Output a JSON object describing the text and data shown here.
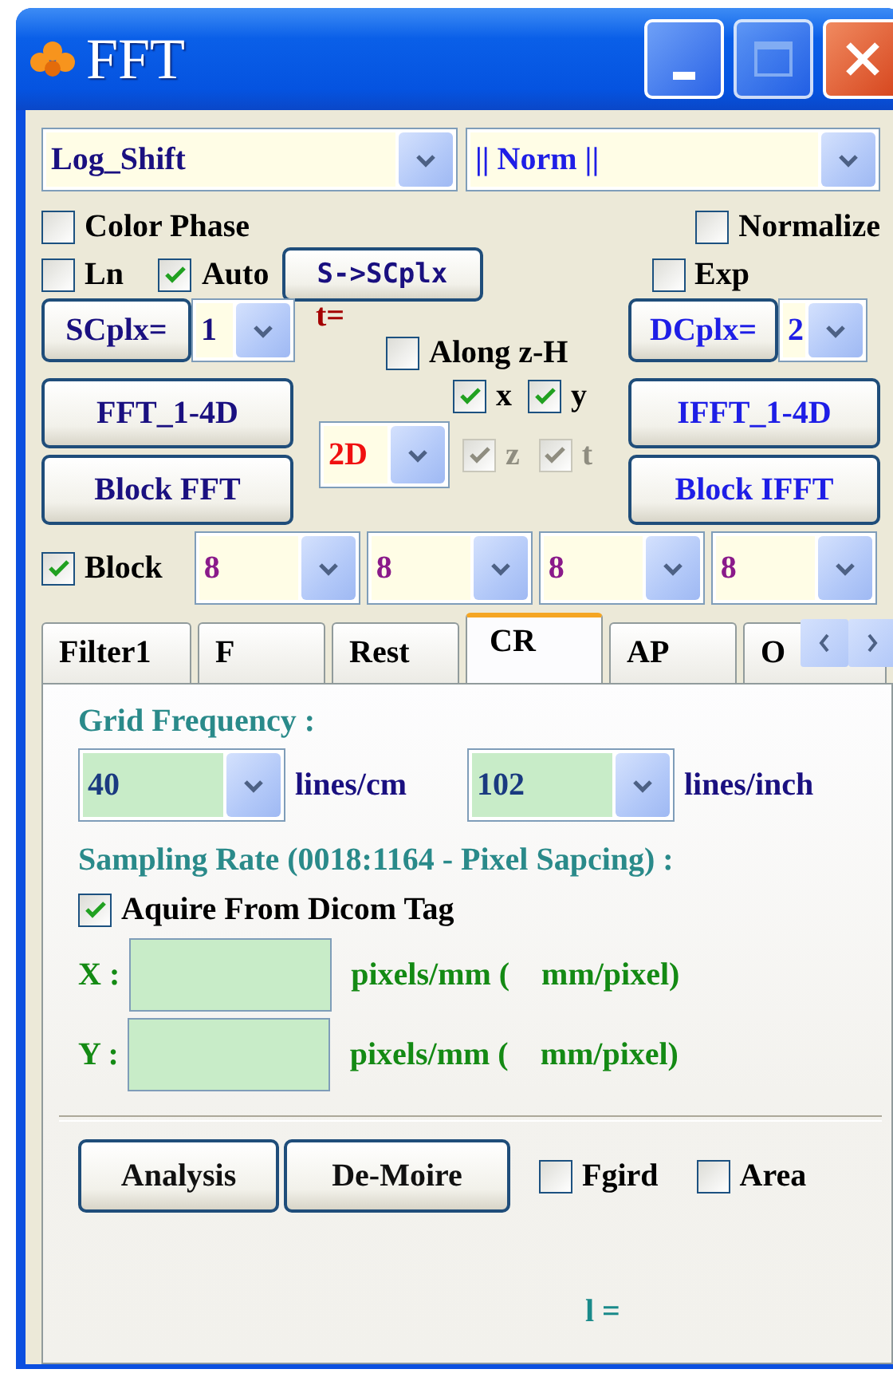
{
  "window": {
    "title": "FFT"
  },
  "mode_select": {
    "value": "Log_Shift"
  },
  "norm_select": {
    "value": "|| Norm ||"
  },
  "color_phase": {
    "label": "Color Phase",
    "checked": false
  },
  "normalize": {
    "label": "Normalize",
    "checked": false
  },
  "ln": {
    "label": "Ln",
    "checked": false
  },
  "auto": {
    "label": "Auto",
    "checked": true
  },
  "s_to_scplx_button": "S->SCplx",
  "exp": {
    "label": "Exp",
    "checked": false
  },
  "scplx": {
    "button": "SCplx=",
    "value": "1"
  },
  "t_label": "t=",
  "dcplx": {
    "button": "DCplx=",
    "value": "2"
  },
  "along_zh": {
    "label": "Along z-H",
    "checked": false
  },
  "axes": [
    {
      "label": "x",
      "checked": true,
      "disabled": false
    },
    {
      "label": "y",
      "checked": true,
      "disabled": false
    },
    {
      "label": "z",
      "checked": true,
      "disabled": true
    },
    {
      "label": "t",
      "checked": true,
      "disabled": true
    }
  ],
  "dimension_select": {
    "value": "2D"
  },
  "fft_button": "FFT_1-4D",
  "block_fft_button": "Block FFT",
  "ifft_button": "IFFT_1-4D",
  "block_ifft_button": "Block IFFT",
  "block": {
    "label": "Block",
    "checked": true,
    "sizes": [
      "8",
      "8",
      "8",
      "8"
    ]
  },
  "tabs": [
    {
      "label": "Filter1",
      "selected": false
    },
    {
      "label": "F",
      "selected": false
    },
    {
      "label": "Rest",
      "selected": false
    },
    {
      "label": "CR",
      "selected": true
    },
    {
      "label": "AP",
      "selected": false
    },
    {
      "label": "O",
      "selected": false
    }
  ],
  "cr_panel": {
    "grid_frequency_label": "Grid Frequency :",
    "per_cm": {
      "value": "40",
      "unit": "lines/cm"
    },
    "per_inch": {
      "value": "102",
      "unit": "lines/inch"
    },
    "sampling_label": "Sampling Rate (0018:1164 - Pixel Sapcing) :",
    "dicom": {
      "label": "Aquire From Dicom Tag",
      "checked": true
    },
    "spacing": [
      {
        "axis": "X :",
        "unit": "pixels/mm (",
        "unit2": "mm/pixel)"
      },
      {
        "axis": "Y :",
        "unit": "pixels/mm (",
        "unit2": "mm/pixel)"
      }
    ],
    "buttons": [
      "Analysis",
      "De-Moire"
    ],
    "checks": [
      {
        "label": "Fgird",
        "checked": false
      },
      {
        "label": "Area",
        "checked": false
      }
    ],
    "result": "l ="
  }
}
